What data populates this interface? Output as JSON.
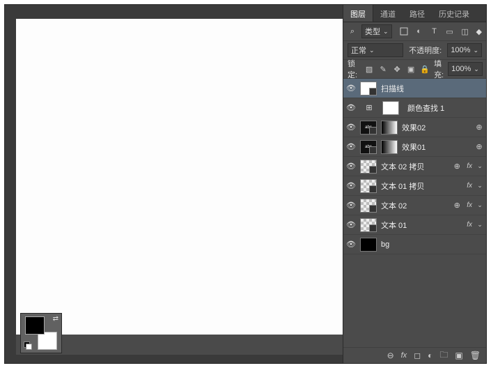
{
  "tabs": {
    "layers": "图层",
    "channels": "通道",
    "paths": "路径",
    "history": "历史记录"
  },
  "filter": {
    "kind_label": "类型"
  },
  "blend": {
    "mode": "正常",
    "opacity_label": "不透明度:",
    "opacity_value": "100%"
  },
  "lock": {
    "label": "锁定:",
    "fill_label": "填充:",
    "fill_value": "100%"
  },
  "layers": [
    {
      "name": "扫描线"
    },
    {
      "name": "颜色查找 1"
    },
    {
      "name": "效果02"
    },
    {
      "name": "效果01"
    },
    {
      "name": "文本 02 拷贝"
    },
    {
      "name": "文本 01 拷贝"
    },
    {
      "name": "文本 02"
    },
    {
      "name": "文本 01"
    },
    {
      "name": "bg"
    }
  ],
  "fx_label": "fx"
}
